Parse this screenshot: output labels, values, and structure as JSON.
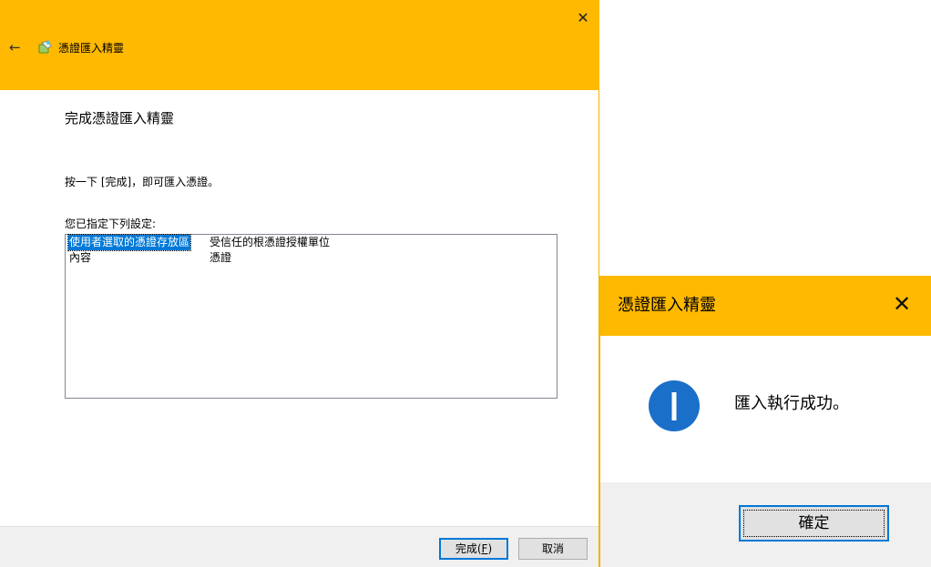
{
  "wizard": {
    "app_name": "憑證匯入精靈",
    "heading": "完成憑證匯入精靈",
    "instruction": "按一下 [完成]，即可匯入憑證。",
    "list_label": "您已指定下列設定:",
    "settings": [
      {
        "key": "使用者選取的憑證存放區",
        "value": "受信任的根憑證授權單位"
      },
      {
        "key": "內容",
        "value": "憑證"
      }
    ],
    "finish_label": "完成(",
    "finish_accel": "F",
    "finish_suffix": ")",
    "cancel_label": "取消",
    "close_glyph": "✕",
    "back_glyph": "←"
  },
  "message_box": {
    "title": "憑證匯入精靈",
    "message": "匯入執行成功。",
    "ok_label": "確定",
    "close_glyph": "✕"
  },
  "colors": {
    "title_bar": "#ffb900",
    "accent": "#0078d7",
    "footer": "#f0f0f0"
  },
  "icons": {
    "back": "back-arrow-icon",
    "app": "certificate-wizard-icon",
    "close": "close-icon",
    "info": "info-icon"
  }
}
